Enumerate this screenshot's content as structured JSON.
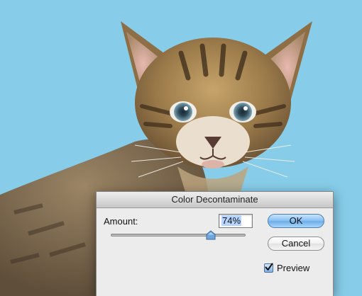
{
  "dialog": {
    "title": "Color Decontaminate",
    "amount_label": "Amount:",
    "amount_value": "74%",
    "amount_fraction": 0.74,
    "ok_label": "OK",
    "cancel_label": "Cancel",
    "preview_label": "Preview",
    "preview_checked": true
  },
  "colors": {
    "background": "#87cde9",
    "accent": "#6eaee9"
  },
  "icons": {
    "slider_thumb": "slider-thumb-icon",
    "checkmark": "checkmark-icon"
  }
}
